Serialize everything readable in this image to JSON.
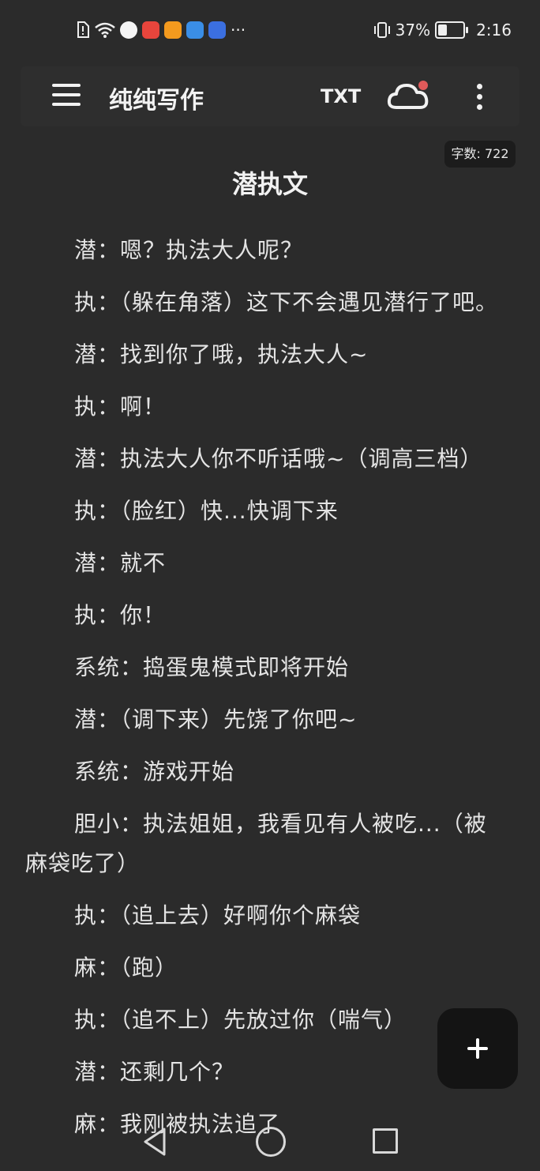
{
  "status_bar": {
    "more_label": "···",
    "battery_label": "37%",
    "battery_level": 0.37,
    "time": "2:16"
  },
  "toolbar": {
    "app_title": "纯纯写作",
    "txt_label": "TXT",
    "icons": [
      "menu-icon",
      "cloud-icon",
      "more-vert-icon"
    ],
    "sync_badge_color": "#e05a5a"
  },
  "document": {
    "word_count": "字数: 722",
    "title": "潜执文",
    "paragraphs": [
      "潜：嗯？执法大人呢？",
      "执：（躲在角落）这下不会遇见潜行了吧。",
      "潜：找到你了哦，执法大人~",
      "执：啊！",
      "潜：执法大人你不听话哦~（调高三档）",
      "执：（脸红）快...快调下来",
      "潜：就不",
      "执：你！",
      "系统：捣蛋鬼模式即将开始",
      "潜：（调下来）先饶了你吧~",
      "系统：游戏开始",
      "胆小：执法姐姐，我看见有人被吃...（被麻袋吃了）",
      "执：（追上去）好啊你个麻袋",
      "麻：（跑）",
      "执：（追不上）先放过你（喘气）",
      "潜：还剩几个？",
      "麻：我刚被执法追了"
    ]
  },
  "fab": {
    "icon": "plus-icon"
  },
  "nav_bar": {
    "icons": [
      "back-icon",
      "home-icon",
      "recent-apps-icon"
    ]
  }
}
